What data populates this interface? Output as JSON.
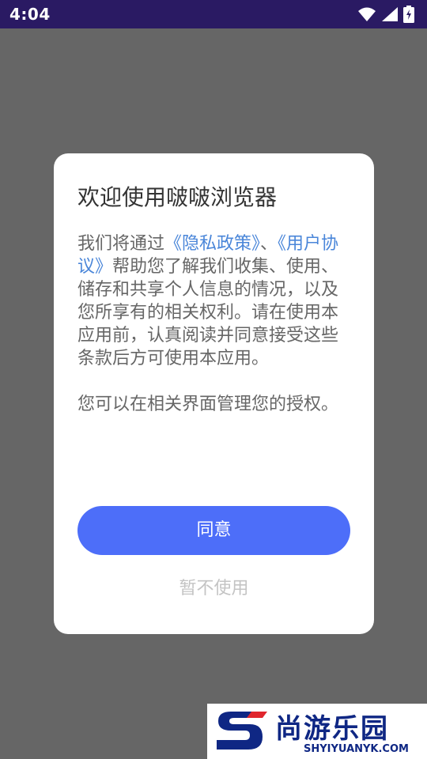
{
  "status_bar": {
    "time": "4:04",
    "icons": [
      "wifi-icon",
      "signal-icon",
      "battery-charging-icon"
    ],
    "background_color": "#2a1a63"
  },
  "dialog": {
    "title": "欢迎使用啵啵浏览器",
    "body_prefix": "我们将通过",
    "privacy_link": "《隐私政策》",
    "separator": "、",
    "agreement_link": "《用户协议》",
    "body_suffix": "帮助您了解我们收集、使用、储存和共享个人信息的情况，以及您所享有的相关权利。请在使用本应用前，认真阅读并同意接受这些条款后方可使用本应用。",
    "body_note": "您可以在相关界面管理您的授权。",
    "agree_label": "同意",
    "decline_label": "暂不使用",
    "link_color": "#4a86d9",
    "button_color": "#4d6ef9"
  },
  "watermark": {
    "name": "尚游乐园",
    "url": "SHYIYUANYK.COM",
    "color": "#0f2784"
  }
}
